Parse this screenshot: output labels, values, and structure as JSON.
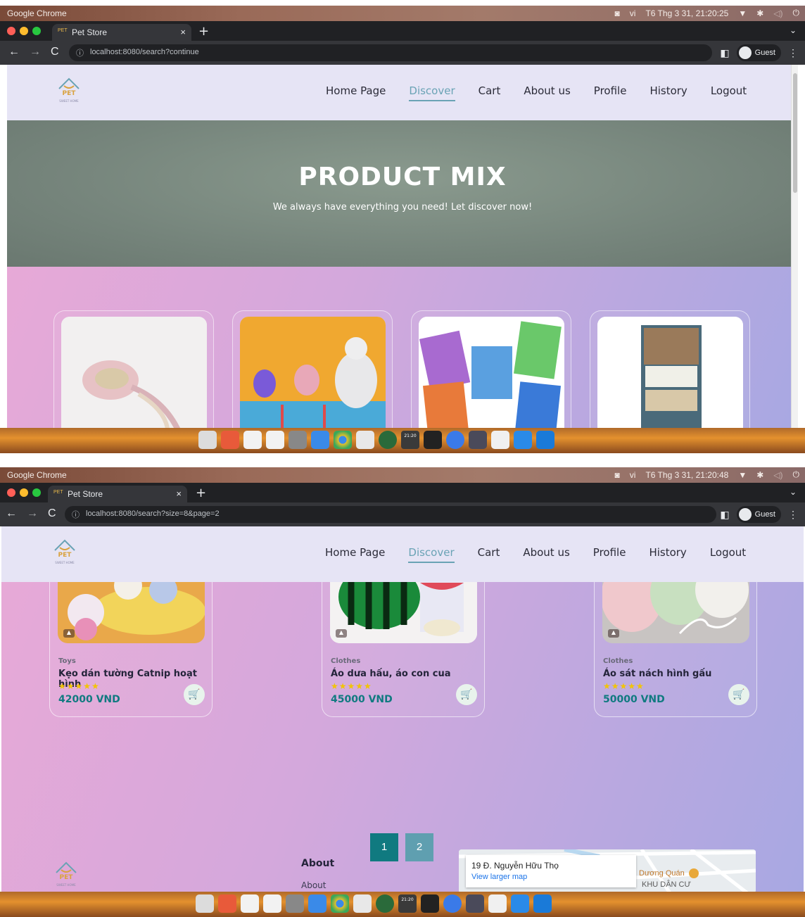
{
  "screens": [
    {
      "os": {
        "app": "Google Chrome",
        "lang": "vi",
        "clock": "T6 Thg 3 31, 21:20:25"
      },
      "browser": {
        "tab_title": "Pet Store",
        "tab_favicon": "PET",
        "url": "localhost:8080/search?continue",
        "profile": "Guest"
      },
      "header": {
        "logo_word": "PET",
        "logo_tag": "SWEET HOME",
        "nav": [
          "Home Page",
          "Discover",
          "Cart",
          "About us",
          "Profile",
          "History",
          "Logout"
        ],
        "active": "Discover"
      },
      "hero": {
        "title": "PRODUCT MIX",
        "subtitle": "We always have everything you need! Let discover now!"
      },
      "dock_clock": "21:20"
    },
    {
      "os": {
        "app": "Google Chrome",
        "lang": "vi",
        "clock": "T6 Thg 3 31, 21:20:48"
      },
      "browser": {
        "tab_title": "Pet Store",
        "tab_favicon": "PET",
        "url": "localhost:8080/search?size=8&page=2",
        "profile": "Guest"
      },
      "header": {
        "logo_word": "PET",
        "logo_tag": "SWEET HOME",
        "nav": [
          "Home Page",
          "Discover",
          "Cart",
          "About us",
          "Profile",
          "History",
          "Logout"
        ],
        "active": "Discover"
      },
      "products": [
        {
          "category": "Toys",
          "name": "Kẹo dán tường Catnip hoạt hình",
          "stars": "★★★★★",
          "price": "42000 VND"
        },
        {
          "category": "Clothes",
          "name": "Áo dưa hấu, áo con cua",
          "stars": "★★★★★",
          "price": "45000 VND"
        },
        {
          "category": "Clothes",
          "name": "Áo sát nách hình gấu",
          "stars": "★★★★★",
          "price": "50000 VND"
        }
      ],
      "pagination": [
        "1",
        "2"
      ],
      "footer": {
        "logo_word": "PET",
        "logo_tag": "SWEET HOME",
        "about_heading": "About",
        "about_link": "About",
        "map_address": "19 Đ. Nguyễn Hữu Thọ",
        "map_link": "View larger map",
        "map_place": "Dương Quán",
        "map_area": "KHU DÂN CƯ"
      },
      "dock_clock": "21:20"
    }
  ],
  "colors": {
    "accent": "#6aa3b5",
    "price": "#107a80",
    "page_active": "#107a80",
    "page_inactive": "#5f9fb0",
    "stars": "#f2c400"
  }
}
